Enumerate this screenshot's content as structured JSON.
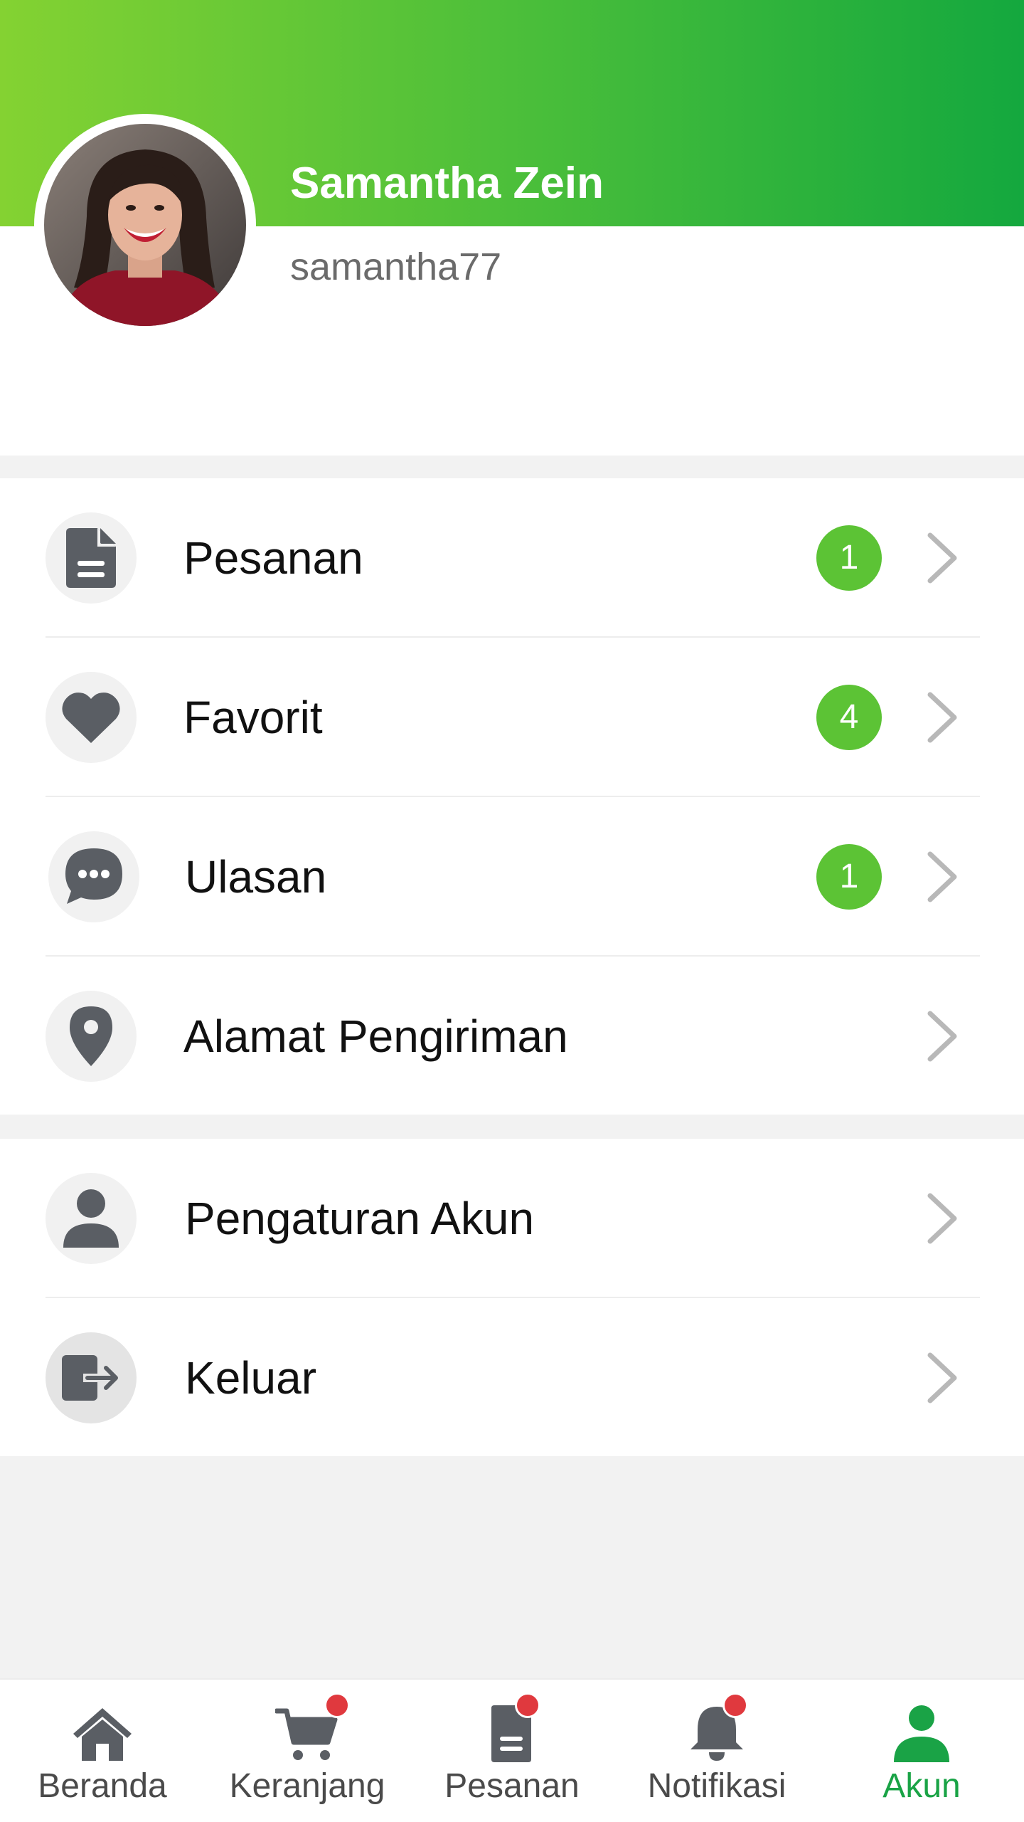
{
  "profile": {
    "name": "Samantha Zein",
    "username": "samantha77"
  },
  "menu": {
    "group1": [
      {
        "label": "Pesanan",
        "icon": "document-icon",
        "badge": "1"
      },
      {
        "label": "Favorit",
        "icon": "heart-icon",
        "badge": "4"
      },
      {
        "label": "Ulasan",
        "icon": "chat-bubble-icon",
        "badge": "1"
      },
      {
        "label": "Alamat Pengiriman",
        "icon": "location-pin-icon",
        "badge": null
      }
    ],
    "group2": [
      {
        "label": "Pengaturan Akun",
        "icon": "person-icon"
      },
      {
        "label": "Keluar",
        "icon": "logout-icon"
      }
    ]
  },
  "bottom_nav": {
    "items": [
      {
        "label": "Beranda",
        "icon": "home-icon",
        "notification_dot": false,
        "active": false
      },
      {
        "label": "Keranjang",
        "icon": "cart-icon",
        "notification_dot": true,
        "active": false
      },
      {
        "label": "Pesanan",
        "icon": "orders-icon",
        "notification_dot": true,
        "active": false
      },
      {
        "label": "Notifikasi",
        "icon": "bell-icon",
        "notification_dot": true,
        "active": false
      },
      {
        "label": "Akun",
        "icon": "account-icon",
        "notification_dot": false,
        "active": true
      }
    ]
  },
  "colors": {
    "header_gradient_start": "#84d232",
    "header_gradient_end": "#14a83e",
    "badge": "#5cc335",
    "active_nav": "#1aa346",
    "notification_dot": "#e0393e",
    "icon_gray": "#5a5e64"
  }
}
